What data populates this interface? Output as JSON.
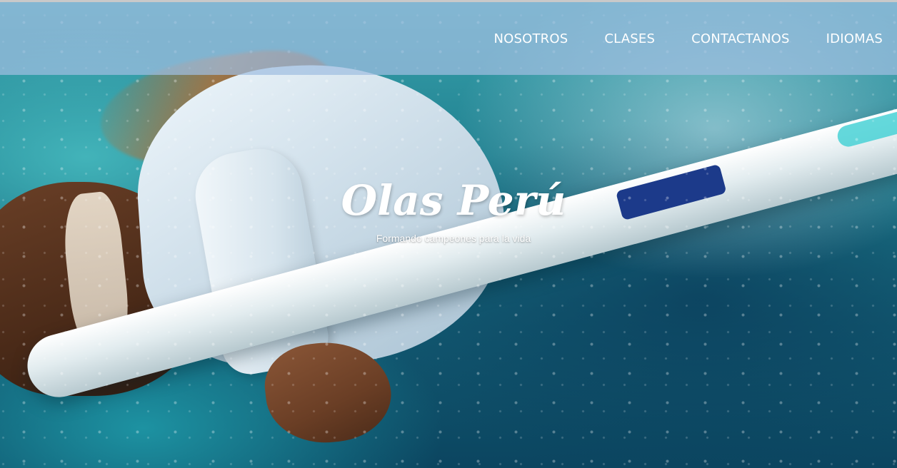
{
  "nav": {
    "items": [
      {
        "label": "NOSOTROS"
      },
      {
        "label": "CLASES"
      },
      {
        "label": "CONTACTANOS"
      },
      {
        "label": "IDIOMAS"
      }
    ]
  },
  "hero": {
    "title": "Olas Perú",
    "subtitle": "Formando campeones para la vida"
  },
  "colors": {
    "navbar_overlay": "#a0bee1",
    "text": "#ffffff",
    "water": "#1f7f8f"
  }
}
